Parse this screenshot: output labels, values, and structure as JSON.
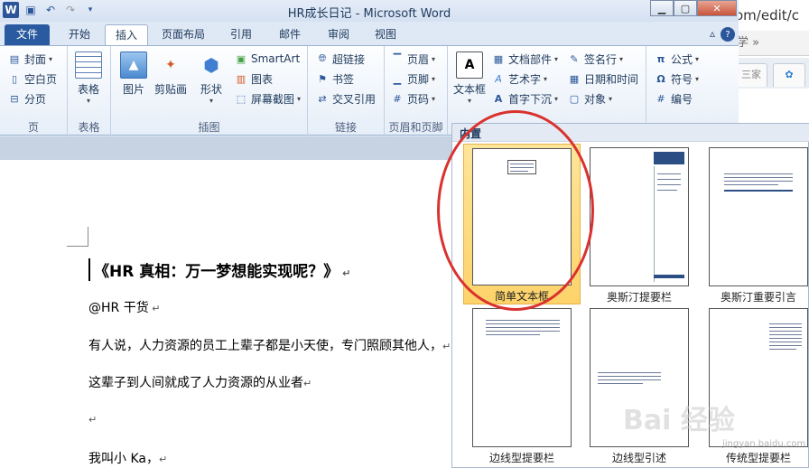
{
  "browser": {
    "url": "om/edit/c",
    "fav_text": "学  »",
    "tab1": "三家",
    "tab2": ""
  },
  "window": {
    "title": "HR成长日记 - Microsoft Word"
  },
  "tabs": [
    {
      "label": "文件"
    },
    {
      "label": "开始"
    },
    {
      "label": "插入"
    },
    {
      "label": "页面布局"
    },
    {
      "label": "引用"
    },
    {
      "label": "邮件"
    },
    {
      "label": "审阅"
    },
    {
      "label": "视图"
    }
  ],
  "ribbon": {
    "pages": {
      "cover": "封面",
      "blank": "空白页",
      "break": "分页",
      "group": "页"
    },
    "tables": {
      "table": "表格",
      "group": "表格"
    },
    "illustrations": {
      "picture": "图片",
      "clipart": "剪贴画",
      "shapes": "形状",
      "smartart": "SmartArt",
      "chart": "图表",
      "screenshot": "屏幕截图",
      "group": "插图"
    },
    "links": {
      "hyperlink": "超链接",
      "bookmark": "书签",
      "crossref": "交叉引用",
      "group": "链接"
    },
    "headerfooter": {
      "header": "页眉",
      "footer": "页脚",
      "pagenum": "页码",
      "group": "页眉和页脚"
    },
    "text": {
      "textbox": "文本框",
      "quickparts": "文档部件",
      "wordart": "艺术字",
      "dropcap": "首字下沉",
      "signature": "签名行",
      "datetime": "日期和时间",
      "object": "对象"
    },
    "symbols": {
      "equation": "公式",
      "symbol": "符号",
      "number": "编号"
    }
  },
  "document": {
    "title": "《HR 真相：万一梦想能实现呢？》",
    "author": "@HR 干货",
    "line1": "有人说，人力资源的员工上辈子都是小天使，专门照顾其他人，",
    "line2": "这辈子到人间就成了人力资源的从业者",
    "line3": "我叫小 Ka，"
  },
  "gallery": {
    "header": "内置",
    "items": [
      "简单文本框",
      "奥斯汀提要栏",
      "奥斯汀重要引言",
      "边线型提要栏",
      "边线型引述",
      "传统型提要栏"
    ]
  },
  "watermark": {
    "text": "Bai 经验",
    "sub": "jingyan.baidu.com"
  }
}
